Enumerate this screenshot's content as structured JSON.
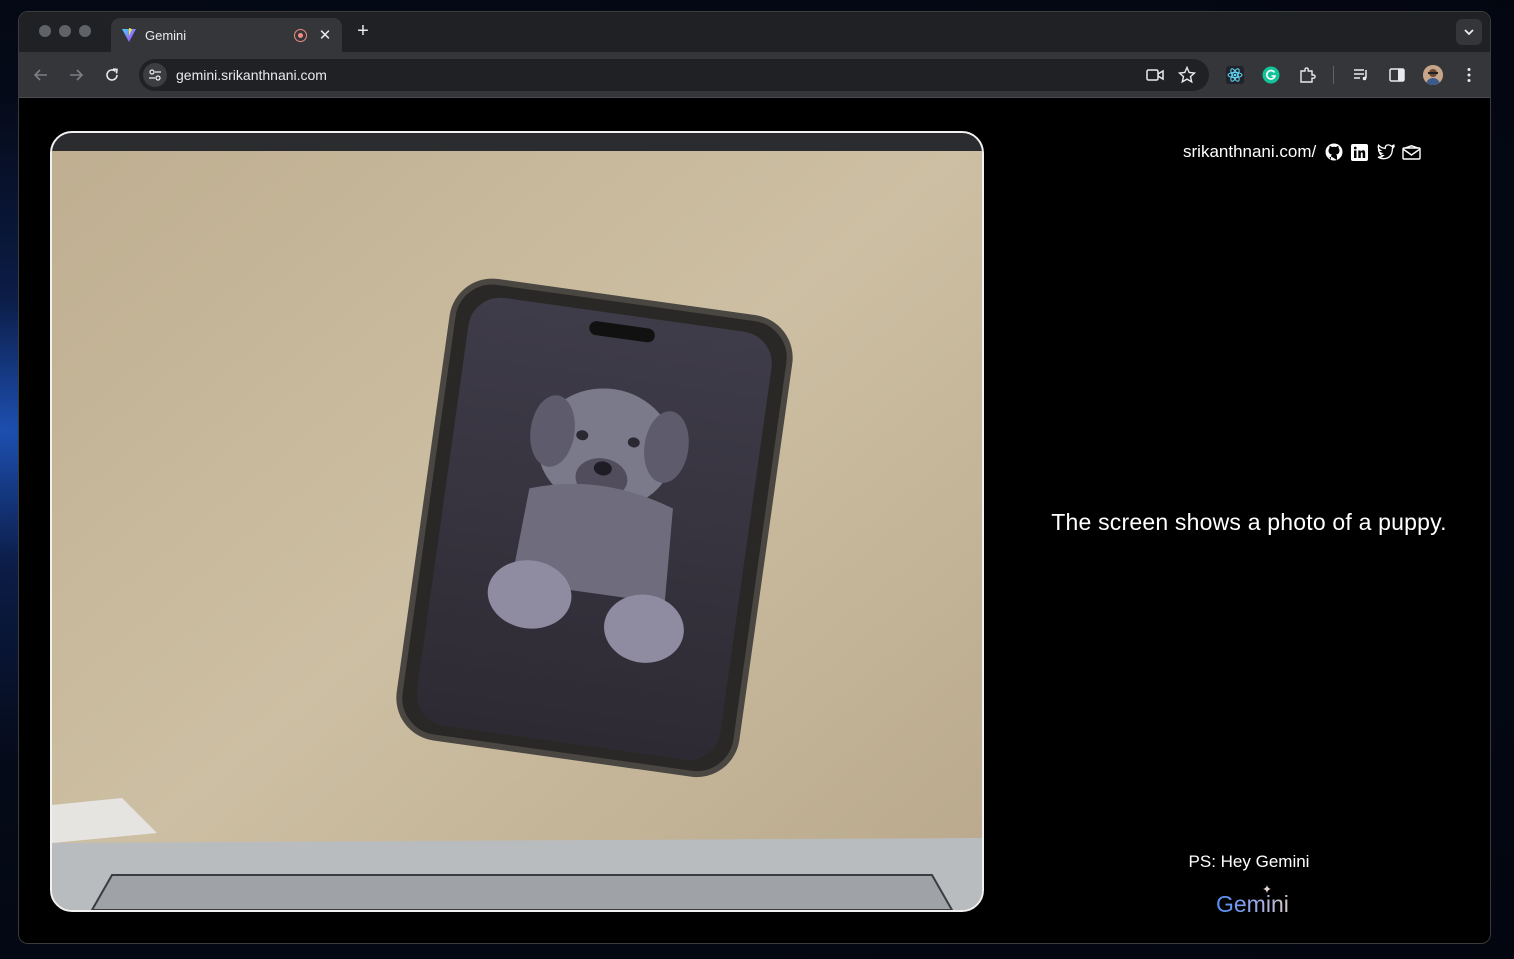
{
  "browser": {
    "tab": {
      "title": "Gemini",
      "favicon": "gemini-favicon",
      "recording_indicator": "recording-icon",
      "close": "close-icon"
    },
    "new_tab": "plus-icon",
    "url": "gemini.srikanthnani.com"
  },
  "page": {
    "header_link": "srikanthnani.com/",
    "social_icons": [
      "github-icon",
      "linkedin-icon",
      "twitter-icon",
      "mail-icon"
    ],
    "response_text": "The screen shows a photo of a puppy.",
    "ps_text": "PS: Hey Gemini",
    "logo_text": "Gemini"
  },
  "colors": {
    "page_background": "#000000",
    "text": "#ffffff",
    "camera_border": "#f1f1f1",
    "gemini_gradient": [
      "#4f8df5",
      "#9aa6e8",
      "#d7c9c9"
    ]
  }
}
